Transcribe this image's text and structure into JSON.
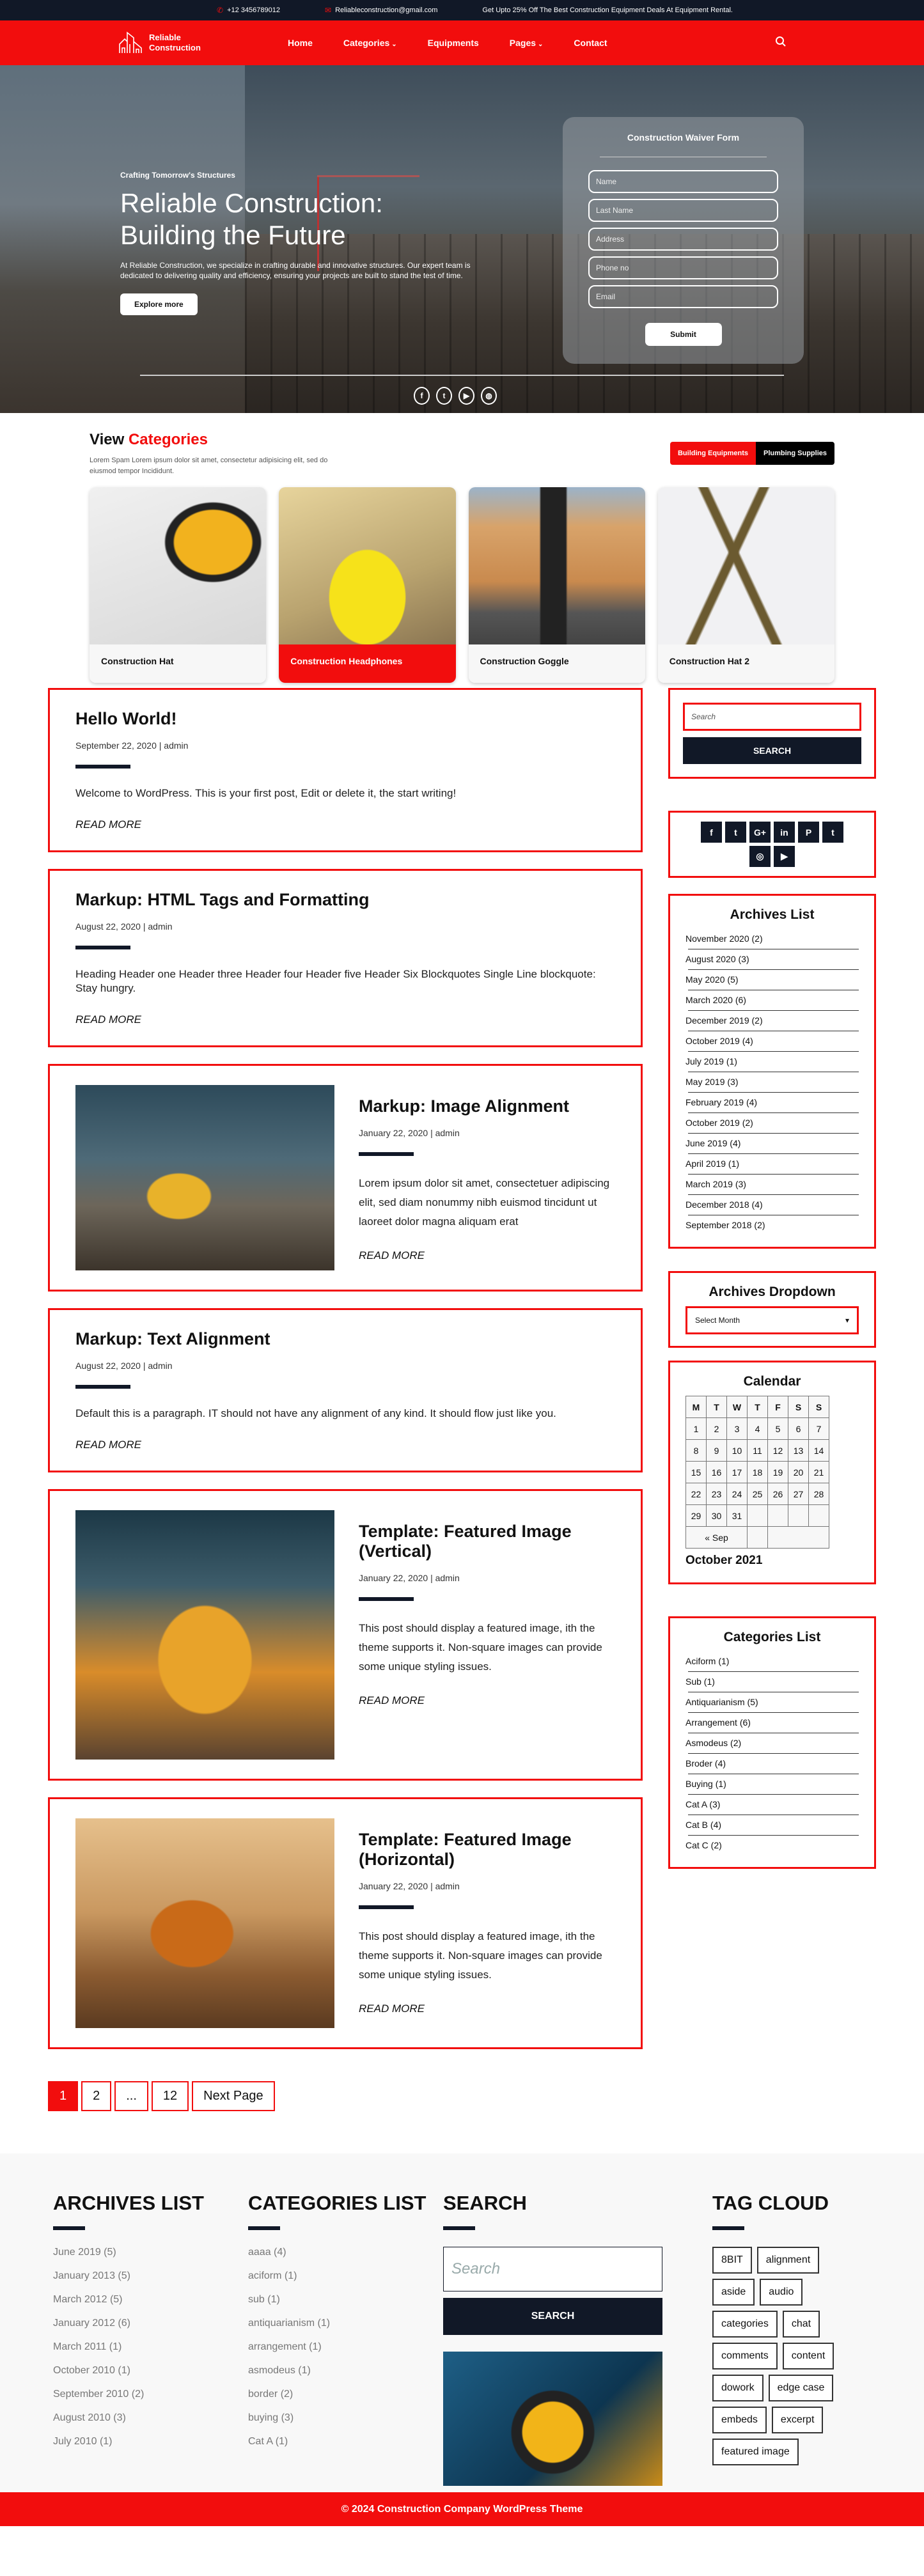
{
  "topbar": {
    "phone": "+12 3456789012",
    "email": "Reliableconstruction@gmail.com",
    "promo": "Get Upto 25% Off The Best Construction Equipment Deals At Equipment Rental."
  },
  "nav": {
    "logo_line1": "Reliable",
    "logo_line2": "Construction",
    "items": [
      {
        "label": "Home",
        "dropdown": false
      },
      {
        "label": "Categories",
        "dropdown": true
      },
      {
        "label": "Equipments",
        "dropdown": false
      },
      {
        "label": "Pages",
        "dropdown": true
      },
      {
        "label": "Contact",
        "dropdown": false
      }
    ],
    "dropdown_glyph": "⌄",
    "search_icon": "search-icon"
  },
  "hero": {
    "subtitle": "Crafting Tomorrow's Structures",
    "title_line1": "Reliable Construction:",
    "title_line2": "Building the Future",
    "description": "At Reliable Construction, we specialize in crafting durable and innovative structures. Our expert team is dedicated to delivering quality and efficiency, ensuring your projects are built to stand the test of time.",
    "cta": "Explore more",
    "socials": [
      "facebook-icon",
      "twitter-icon",
      "youtube-icon",
      "dribbble-icon"
    ]
  },
  "form": {
    "title": "Construction Waiver Form",
    "fields": [
      "Name",
      "Last Name",
      "Address",
      "Phone no",
      "Email"
    ],
    "submit": "Submit"
  },
  "categories": {
    "title_plain": "View",
    "title_accent": "Categories",
    "description": "Lorem Spam Lorem ipsum dolor sit amet, consectetur adipisicing elit, sed do eiusmod tempor Incididunt.",
    "tabs": [
      {
        "label": "Building Equipments",
        "active": true
      },
      {
        "label": "Plumbing Supplies",
        "active": false
      }
    ],
    "cards": [
      {
        "label": "Construction Hat",
        "active": false
      },
      {
        "label": "Construction Headphones",
        "active": true
      },
      {
        "label": "Construction Goggle",
        "active": false
      },
      {
        "label": "Construction Hat 2",
        "active": false
      }
    ]
  },
  "posts": [
    {
      "title": "Hello World!",
      "meta": "September 22, 2020 | admin",
      "excerpt": "Welcome to WordPress. This is your first post, Edit or delete it, the start writing!",
      "read_more": "READ MORE",
      "image": false
    },
    {
      "title": "Markup: HTML Tags and Formatting",
      "meta": "August 22, 2020 | admin",
      "excerpt": "Heading Header one Header three Header four Header five Header Six Blockquotes Single Line blockquote: Stay hungry.",
      "read_more": "READ MORE",
      "image": false
    },
    {
      "title": "Markup: Image Alignment",
      "meta": "January 22, 2020 | admin",
      "excerpt": "Lorem ipsum dolor sit amet, consectetuer adipiscing elit, sed diam nonummy nibh euismod tincidunt ut laoreet dolor magna aliquam erat",
      "read_more": "READ MORE",
      "image": true
    },
    {
      "title": "Markup: Text Alignment",
      "meta": "August 22, 2020 | admin",
      "excerpt": "Default this is a paragraph. IT should not have any alignment of any kind. It should flow just like you.",
      "read_more": "READ MORE",
      "image": false
    },
    {
      "title": "Template: Featured Image (Vertical)",
      "meta": "January 22, 2020 | admin",
      "excerpt": "This post should display a featured image, ith the theme supports it. Non-square images can provide some unique styling issues.",
      "read_more": "READ MORE",
      "image": true
    },
    {
      "title": "Template: Featured Image (Horizontal)",
      "meta": "January 22, 2020 | admin",
      "excerpt": "This post should display a featured image, ith the theme supports it. Non-square images can provide some unique styling issues.",
      "read_more": "READ MORE",
      "image": true
    }
  ],
  "pagination": {
    "pages": [
      {
        "label": "1",
        "active": true
      },
      {
        "label": "2",
        "active": false
      },
      {
        "label": "...",
        "active": false
      },
      {
        "label": "12",
        "active": false
      },
      {
        "label": "Next Page",
        "active": false
      }
    ]
  },
  "sidebar": {
    "search_placeholder": "Search",
    "search_button": "SEARCH",
    "social_icons": [
      {
        "name": "facebook-icon",
        "glyph": "f"
      },
      {
        "name": "twitter-icon",
        "glyph": "t"
      },
      {
        "name": "google-plus-icon",
        "glyph": "G+"
      },
      {
        "name": "linkedin-icon",
        "glyph": "in"
      },
      {
        "name": "pinterest-icon",
        "glyph": "P"
      },
      {
        "name": "tumblr-icon",
        "glyph": "t"
      },
      {
        "name": "instagram-icon",
        "glyph": "◎"
      },
      {
        "name": "youtube-icon",
        "glyph": "▶"
      }
    ],
    "archives_title": "Archives List",
    "archives": [
      "November 2020 (2)",
      "August 2020 (3)",
      "May 2020 (5)",
      "March 2020 (6)",
      "December 2019 (2)",
      "October 2019 (4)",
      "July 2019 (1)",
      "May 2019 (3)",
      "February 2019 (4)",
      "October 2019 (2)",
      "June 2019 (4)",
      "April 2019 (1)",
      "March 2019 (3)",
      "December 2018 (4)",
      "September 2018 (2)"
    ],
    "dropdown_title": "Archives Dropdown",
    "dropdown_value": "Select Month",
    "calendar_title": "Calendar",
    "calendar_headers": [
      "M",
      "T",
      "W",
      "T",
      "F",
      "S",
      "S"
    ],
    "calendar_weeks": [
      [
        "1",
        "2",
        "3",
        "4",
        "5",
        "6",
        "7"
      ],
      [
        "8",
        "9",
        "10",
        "11",
        "12",
        "13",
        "14"
      ],
      [
        "15",
        "16",
        "17",
        "18",
        "19",
        "20",
        "21"
      ],
      [
        "22",
        "23",
        "24",
        "25",
        "26",
        "27",
        "28"
      ],
      [
        "29",
        "30",
        "31",
        "",
        "",
        "",
        ""
      ]
    ],
    "calendar_prev": "« Sep",
    "calendar_caption": "October 2021",
    "categories_title": "Categories List",
    "categories": [
      "Aciform (1)",
      "Sub (1)",
      "Antiquarianism (5)",
      "Arrangement (6)",
      "Asmodeus (2)",
      "Broder (4)",
      "Buying (1)",
      "Cat A (3)",
      "Cat B (4)",
      "Cat C (2)"
    ]
  },
  "footer": {
    "archives_title": "ARCHIVES LIST",
    "archives": [
      "June 2019 (5)",
      "January  2013 (5)",
      "March 2012 (5)",
      "January  2012 (6)",
      "March  2011 (1)",
      "October 2010 (1)",
      "September 2010 (2)",
      "August 2010 (3)",
      "July 2010 (1)"
    ],
    "categories_title": "CATEGORIES LIST",
    "categories": [
      "aaaa (4)",
      "aciform (1)",
      "sub (1)",
      "antiquarianism (1)",
      "arrangement (1)",
      "asmodeus (1)",
      "border (2)",
      "buying (3)",
      "Cat A (1)"
    ],
    "search_title": "SEARCH",
    "search_placeholder": "Search",
    "search_button": "SEARCH",
    "tags_title": "TAG CLOUD",
    "tags": [
      "8BIT",
      "alignment",
      "aside",
      "audio",
      "categories",
      "chat",
      "comments",
      "content",
      "dowork",
      "edge case",
      "embeds",
      "excerpt",
      "featured image"
    ],
    "copyright": "© 2024  Construction Company WordPress Theme"
  },
  "colors": {
    "accent": "#f20d0d",
    "dark": "#111827"
  }
}
